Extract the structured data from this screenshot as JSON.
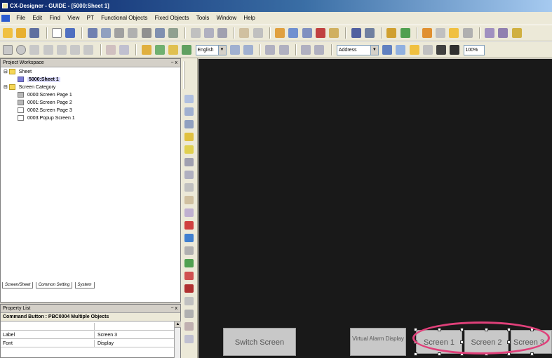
{
  "window": {
    "title": "CX-Designer - GUIDE - [5000:Sheet 1]"
  },
  "menu": [
    "File",
    "Edit",
    "Find",
    "View",
    "PT",
    "Functional Objects",
    "Fixed Objects",
    "Tools",
    "Window",
    "Help"
  ],
  "toolbar": {
    "language_combo": "English",
    "address_combo": "Address",
    "zoom_value": "100%"
  },
  "workspace": {
    "title": "Project Workspace",
    "pin": "− x",
    "tree": [
      {
        "label": "Sheet",
        "indent": 0,
        "icon": "folder-icon"
      },
      {
        "label": "5000:Sheet 1",
        "indent": 1,
        "icon": "sheet-icon",
        "selected": true
      },
      {
        "label": "Screen Category",
        "indent": 0,
        "icon": "folder-icon"
      },
      {
        "label": "0000:Screen Page 1",
        "indent": 1,
        "icon": "screen-icon"
      },
      {
        "label": "0001:Screen Page 2",
        "indent": 1,
        "icon": "screen-icon"
      },
      {
        "label": "0002:Screen Page 3",
        "indent": 1,
        "icon": "screen-icon"
      },
      {
        "label": "0003:Popup Screen 1",
        "indent": 1,
        "icon": "popup-icon"
      }
    ],
    "tabs": [
      "Screen/Sheet",
      "Common Setting",
      "System"
    ]
  },
  "property": {
    "title": "Property List",
    "pin": "− x",
    "object_title": "Command Button : PBC0004  Multiple Objects",
    "rows": [
      {
        "key": "",
        "value": ""
      },
      {
        "key": "Label",
        "value": "Screen 3"
      },
      {
        "key": "Font",
        "value": "Display"
      }
    ]
  },
  "canvas": {
    "buttons": [
      {
        "name": "switch-screen-button",
        "label": "Switch Screen"
      },
      {
        "name": "virtual-alarm-display-button",
        "label": "Virtual Alarm Display"
      },
      {
        "name": "screen-1-button",
        "label": "Screen 1"
      },
      {
        "name": "screen-2-button",
        "label": "Screen 2"
      },
      {
        "name": "screen-3-button",
        "label": "Screen 3"
      }
    ]
  },
  "colors": {
    "canvas_bg": "#191919",
    "highlight_ellipse": "#e0407a",
    "title_gradient_start": "#0a246a"
  }
}
